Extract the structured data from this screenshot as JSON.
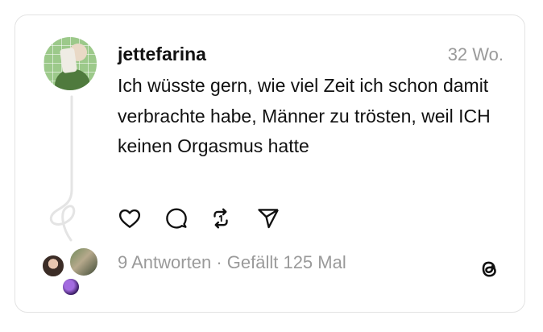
{
  "post": {
    "username": "jettefarina",
    "timestamp": "32 Wo.",
    "text": "Ich wüsste gern, wie viel Zeit ich schon damit verbrachte habe, Männer zu trösten, weil ICH keinen Orgasmus hatte",
    "replies_label": "9 Antworten",
    "separator": "·",
    "likes_label": "Gefällt 125 Mal"
  },
  "actions": [
    {
      "icon": "heart-icon"
    },
    {
      "icon": "comment-icon"
    },
    {
      "icon": "repost-icon"
    },
    {
      "icon": "share-icon"
    }
  ],
  "colors": {
    "text": "#111111",
    "muted": "#9a9a9a",
    "border": "#e3e3e3",
    "thread_line": "#e4e4e4"
  }
}
